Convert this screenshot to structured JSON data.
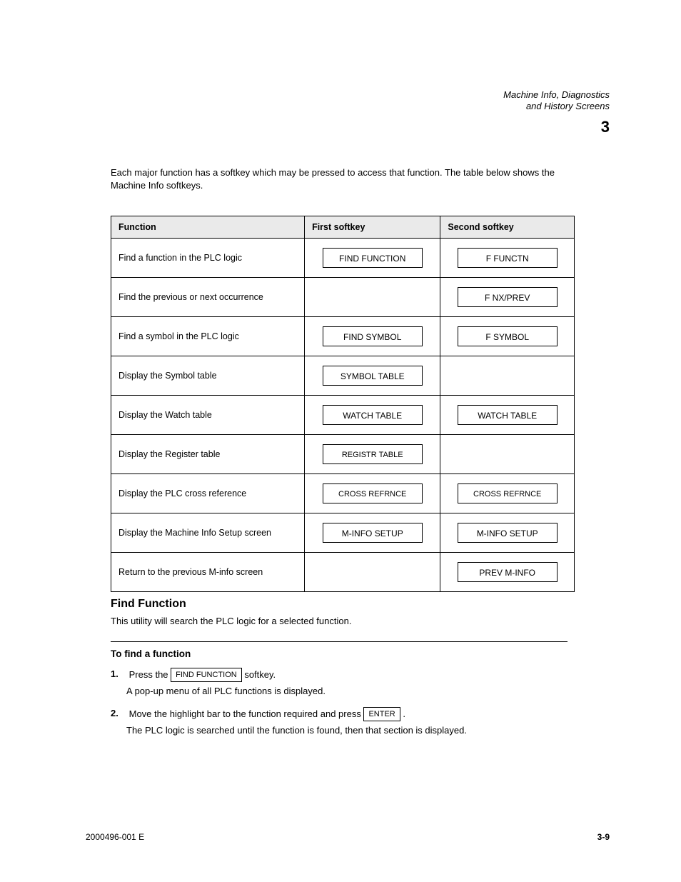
{
  "header": {
    "title_line1": "Machine Info, Diagnostics",
    "title_line2": "and History Screens",
    "section_number": "3"
  },
  "intro_text": "Each major function has a softkey which may be pressed to access that function. The table below shows the Machine Info softkeys.",
  "table": {
    "columns": [
      "Function",
      "First softkey",
      "Second softkey"
    ],
    "rows": [
      {
        "function": "Find a function in the PLC logic",
        "first": "FIND FUNCTION",
        "second": "F FUNCTN"
      },
      {
        "function": "Find the previous or next occurrence",
        "first": "",
        "second": "F NX/PREV"
      },
      {
        "function": "Find a symbol in the PLC logic",
        "first": "FIND SYMBOL",
        "second": "F SYMBOL"
      },
      {
        "function": "Display the Symbol table",
        "first": "SYMBOL TABLE",
        "second": ""
      },
      {
        "function": "Display the Watch table",
        "first": "WATCH TABLE",
        "second": "WATCH TABLE"
      },
      {
        "function": "Display the Register table",
        "first": "REGISTR TABLE",
        "second": ""
      },
      {
        "function": "Display the PLC cross reference",
        "first": "CROSS REFRNCE",
        "second": "CROSS REFRNCE"
      },
      {
        "function": "Display the Machine Info Setup screen",
        "first": "M-INFO SETUP",
        "second": "M-INFO SETUP"
      },
      {
        "function": "Return to the previous M-info screen",
        "first": "",
        "second": "PREV M-INFO"
      }
    ]
  },
  "findfunc": {
    "heading": "Find Function",
    "description": "This utility will search the PLC logic for a selected function.",
    "steps_heading": "To find a function",
    "step1_prefix": "Press the ",
    "step1_button": "FIND FUNCTION",
    "step1_suffix": " softkey.",
    "step1_note": "A pop-up menu of all PLC functions is displayed.",
    "step2_prefix": "Move the highlight bar to the function required and press ",
    "step2_button": "ENTER",
    "step2_suffix": ".",
    "step2_note": "The PLC logic is searched until the function is found, then that section is displayed."
  },
  "footer": {
    "doc": "2000496-001 E",
    "page": "3-9"
  }
}
